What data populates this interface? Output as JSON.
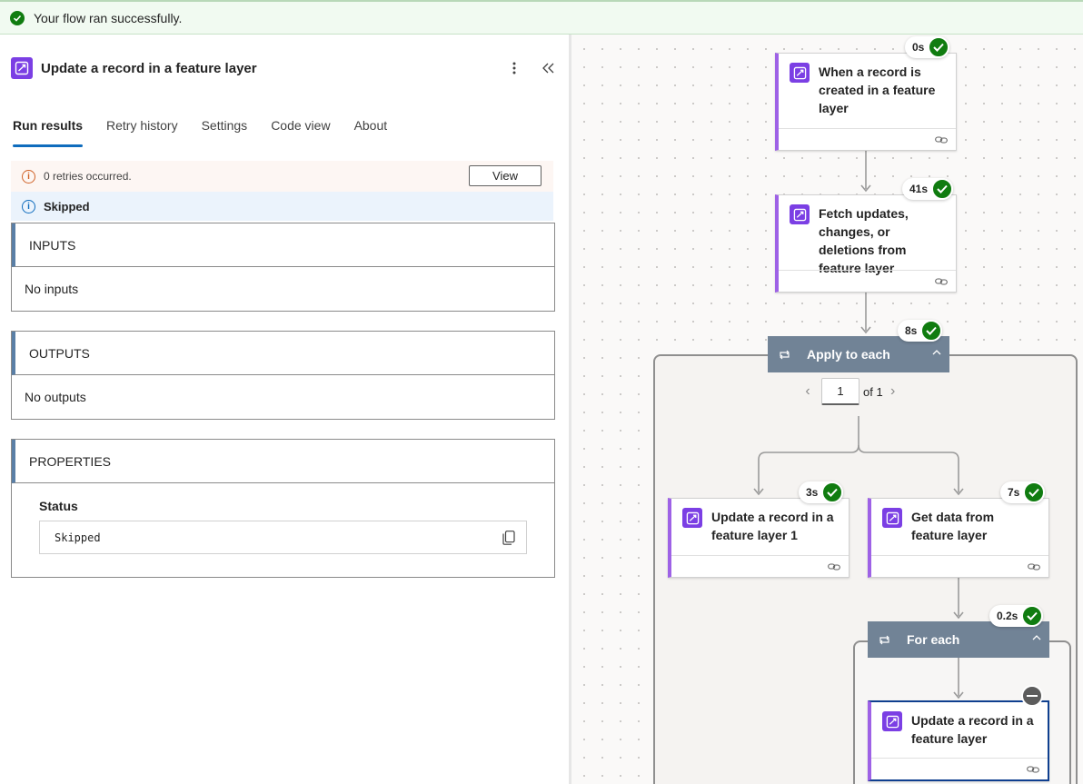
{
  "banner": {
    "message": "Your flow ran successfully."
  },
  "panel": {
    "title": "Update a record in a feature layer",
    "tabs": [
      {
        "label": "Run results",
        "active": true
      },
      {
        "label": "Retry history"
      },
      {
        "label": "Settings"
      },
      {
        "label": "Code view"
      },
      {
        "label": "About"
      }
    ],
    "retry": {
      "message": "0 retries occurred.",
      "button": "View"
    },
    "status_bar": "Skipped",
    "inputs": {
      "heading": "INPUTS",
      "body": "No inputs"
    },
    "outputs": {
      "heading": "OUTPUTS",
      "body": "No outputs"
    },
    "properties": {
      "heading": "PROPERTIES",
      "label": "Status",
      "value": "Skipped"
    }
  },
  "canvas": {
    "steps": [
      {
        "title": "When a record is created in a feature layer",
        "duration": "0s",
        "status": "success"
      },
      {
        "title": "Fetch updates, changes, or deletions from feature layer",
        "duration": "41s",
        "status": "success"
      },
      {
        "title": "Update a record in a feature layer 1",
        "duration": "3s",
        "status": "success"
      },
      {
        "title": "Get data from feature layer",
        "duration": "7s",
        "status": "success"
      },
      {
        "title": "Update a record in a feature layer",
        "duration": "",
        "status": "skipped"
      }
    ],
    "apply_to_each": {
      "label": "Apply to each",
      "duration": "8s",
      "page": "1",
      "of_label": "of 1"
    },
    "for_each": {
      "label": "For each",
      "duration": "0.2s"
    }
  },
  "colors": {
    "success": "#107c10",
    "accent": "#0f6cbd",
    "action": "#7b3fe4",
    "scope": "#718396"
  },
  "icons": [
    "check-circle-icon",
    "flow-action-icon",
    "more-vertical-icon",
    "collapse-left-icon",
    "warning-info-icon",
    "info-icon",
    "copy-icon",
    "link-icon",
    "loop-icon",
    "chevron-up-icon",
    "chevron-left-icon",
    "chevron-right-icon",
    "skipped-icon"
  ]
}
